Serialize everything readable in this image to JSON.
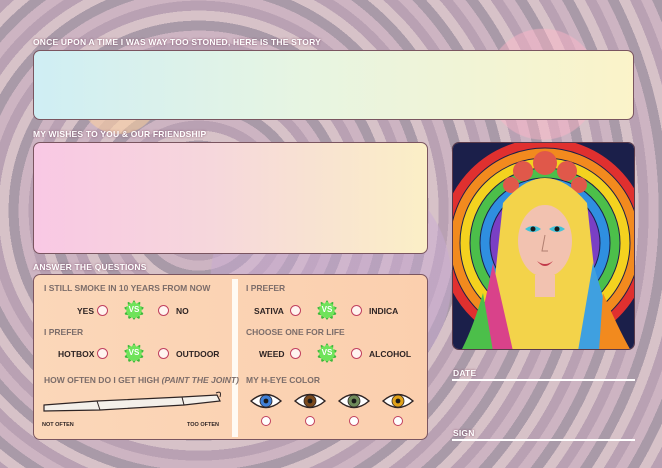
{
  "story": {
    "label": "ONCE UPON A TIME I WAS WAY TOO STONED, HERE IS THE STORY"
  },
  "wishes": {
    "label": "MY WISHES TO YOU & OUR FRIENDSHIP"
  },
  "questions": {
    "label": "ANSWER THE QUESTIONS",
    "smoke_10_years": {
      "title": "I STILL SMOKE IN 10 YEARS FROM NOW",
      "option_a": "YES",
      "vs": "VS",
      "option_b": "NO"
    },
    "prefer_place": {
      "title": "I PREFER",
      "option_a": "HOTBOX",
      "vs": "VS",
      "option_b": "OUTDOOR"
    },
    "how_often": {
      "title": "HOW OFTEN DO I GET HIGH",
      "title_italic": "(PAINT THE JOINT)",
      "min_label": "NOT OFTEN",
      "max_label": "TOO OFTEN"
    },
    "prefer_strain": {
      "title": "I PREFER",
      "option_a": "SATIVA",
      "vs": "VS",
      "option_b": "INDICA"
    },
    "life_choice": {
      "title": "CHOOSE ONE FOR LIFE",
      "option_a": "WEED",
      "vs": "VS",
      "option_b": "ALCOHOL"
    },
    "eye_color": {
      "title": "MY H-EYE COLOR",
      "options": [
        {
          "icon": "blue-eye-icon",
          "color": "#3f7fd6"
        },
        {
          "icon": "brown-eye-icon",
          "color": "#7a4a1e"
        },
        {
          "icon": "green-eye-icon",
          "color": "#6f8a5a"
        },
        {
          "icon": "amber-eye-icon",
          "color": "#e0a21a"
        }
      ]
    }
  },
  "signature": {
    "date_label": "DATE",
    "sign_label": "SIGN"
  },
  "colors": {
    "accent_green": "#4ccc3e",
    "radio_border": "#c0405f",
    "panel_border": "#7a5560"
  }
}
